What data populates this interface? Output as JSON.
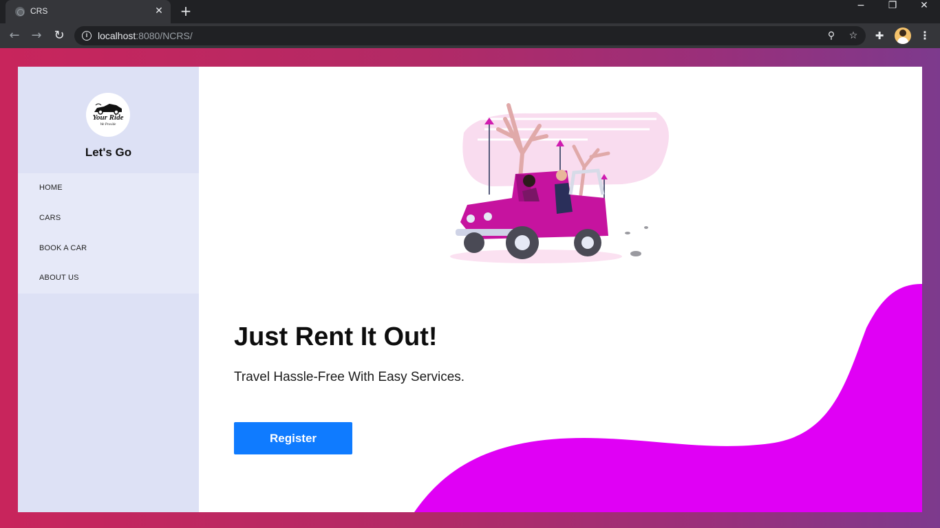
{
  "browser": {
    "tab_title": "CRS",
    "url_host": "localhost",
    "url_rest": ":8080/NCRS/"
  },
  "sidebar": {
    "logo_text": "Your Ride",
    "logo_sub": "We Provide",
    "brand_title": "Let's Go",
    "nav": [
      {
        "label": "HOME"
      },
      {
        "label": "CARS"
      },
      {
        "label": "BOOK A CAR"
      },
      {
        "label": "ABOUT US"
      }
    ]
  },
  "hero": {
    "headline": "Just Rent It Out!",
    "subline": "Travel Hassle-Free With Easy Services.",
    "register_label": "Register"
  },
  "colors": {
    "accent_blue": "#0f7bff",
    "blob_magenta": "#e000f5",
    "sidebar_bg": "#dde1f5"
  }
}
